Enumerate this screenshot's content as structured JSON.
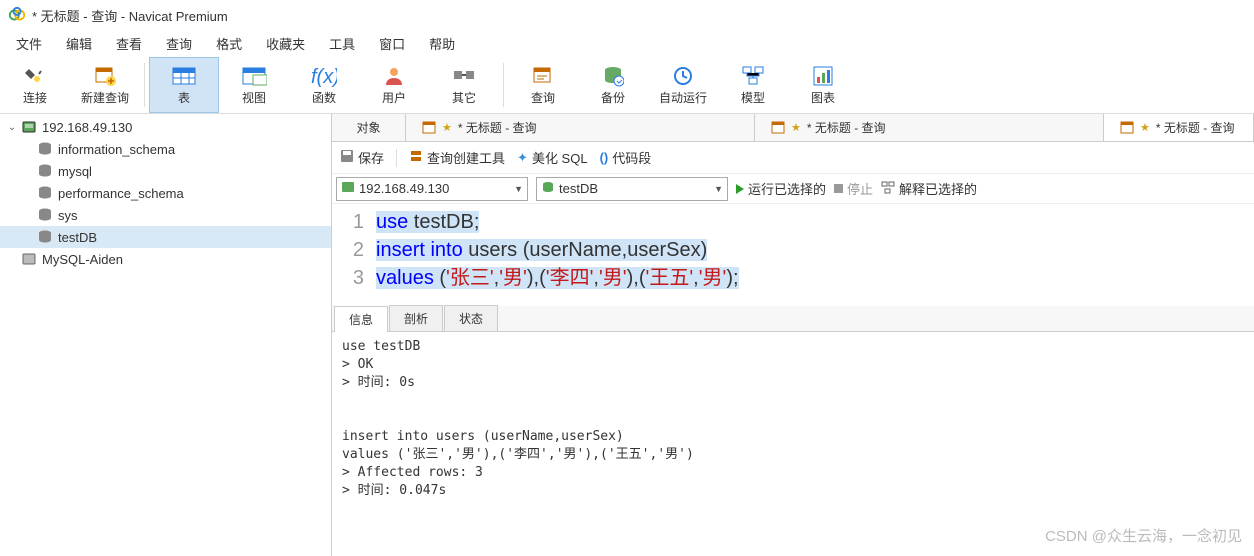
{
  "title": "* 无标题 - 查询 - Navicat Premium",
  "menubar": [
    "文件",
    "编辑",
    "查看",
    "查询",
    "格式",
    "收藏夹",
    "工具",
    "窗口",
    "帮助"
  ],
  "toolbar": [
    {
      "label": "连接",
      "icon": "plug"
    },
    {
      "label": "新建查询",
      "icon": "new-query"
    },
    {
      "sep": true
    },
    {
      "label": "表",
      "icon": "table",
      "active": true
    },
    {
      "label": "视图",
      "icon": "view"
    },
    {
      "label": "函数",
      "icon": "fx"
    },
    {
      "label": "用户",
      "icon": "user"
    },
    {
      "label": "其它",
      "icon": "other"
    },
    {
      "sep": true
    },
    {
      "label": "查询",
      "icon": "query"
    },
    {
      "label": "备份",
      "icon": "backup"
    },
    {
      "label": "自动运行",
      "icon": "auto"
    },
    {
      "label": "模型",
      "icon": "model"
    },
    {
      "label": "图表",
      "icon": "chart"
    }
  ],
  "sidebar": {
    "server": "192.168.49.130",
    "databases": [
      "information_schema",
      "mysql",
      "performance_schema",
      "sys",
      "testDB"
    ],
    "selected": "testDB",
    "other": "MySQL-Aiden"
  },
  "tabs": {
    "first": "对象",
    "items": [
      {
        "label": "* 无标题 - 查询",
        "active": false
      },
      {
        "label": "* 无标题 - 查询",
        "active": false
      },
      {
        "label": "* 无标题 - 查询",
        "active": true
      }
    ]
  },
  "queryToolbar": {
    "save": "保存",
    "builder": "查询创建工具",
    "beautify": "美化 SQL",
    "snippet": "代码段"
  },
  "connRow": {
    "connection": "192.168.49.130",
    "database": "testDB",
    "run": "运行已选择的",
    "stop": "停止",
    "explain": "解释已选择的"
  },
  "editor": {
    "lines": [
      {
        "n": "1",
        "seg": [
          {
            "t": "use",
            "c": "kw sel"
          },
          {
            "t": " testDB;",
            "c": "sel"
          }
        ]
      },
      {
        "n": "2",
        "seg": [
          {
            "t": "insert",
            "c": "kw sel"
          },
          {
            "t": " ",
            "c": "sel"
          },
          {
            "t": "into",
            "c": "kw sel"
          },
          {
            "t": " users (userName,userSex)",
            "c": "sel"
          }
        ]
      },
      {
        "n": "3",
        "seg": [
          {
            "t": "values",
            "c": "kw sel"
          },
          {
            "t": " (",
            "c": "sel"
          },
          {
            "t": "'张三'",
            "c": "str sel"
          },
          {
            "t": ",",
            "c": "sel"
          },
          {
            "t": "'男'",
            "c": "str sel"
          },
          {
            "t": "),(",
            "c": "sel"
          },
          {
            "t": "'李四'",
            "c": "str sel"
          },
          {
            "t": ",",
            "c": "sel"
          },
          {
            "t": "'男'",
            "c": "str sel"
          },
          {
            "t": "),(",
            "c": "sel"
          },
          {
            "t": "'王五'",
            "c": "str sel"
          },
          {
            "t": ",",
            "c": "sel"
          },
          {
            "t": "'男'",
            "c": "str sel"
          },
          {
            "t": ");",
            "c": "sel"
          }
        ]
      }
    ]
  },
  "outTabs": [
    "信息",
    "剖析",
    "状态"
  ],
  "output": "use testDB\n> OK\n> 时间: 0s\n\n\ninsert into users (userName,userSex)\nvalues ('张三','男'),('李四','男'),('王五','男')\n> Affected rows: 3\n> 时间: 0.047s",
  "watermark": "CSDN @众生云海，一念初见"
}
